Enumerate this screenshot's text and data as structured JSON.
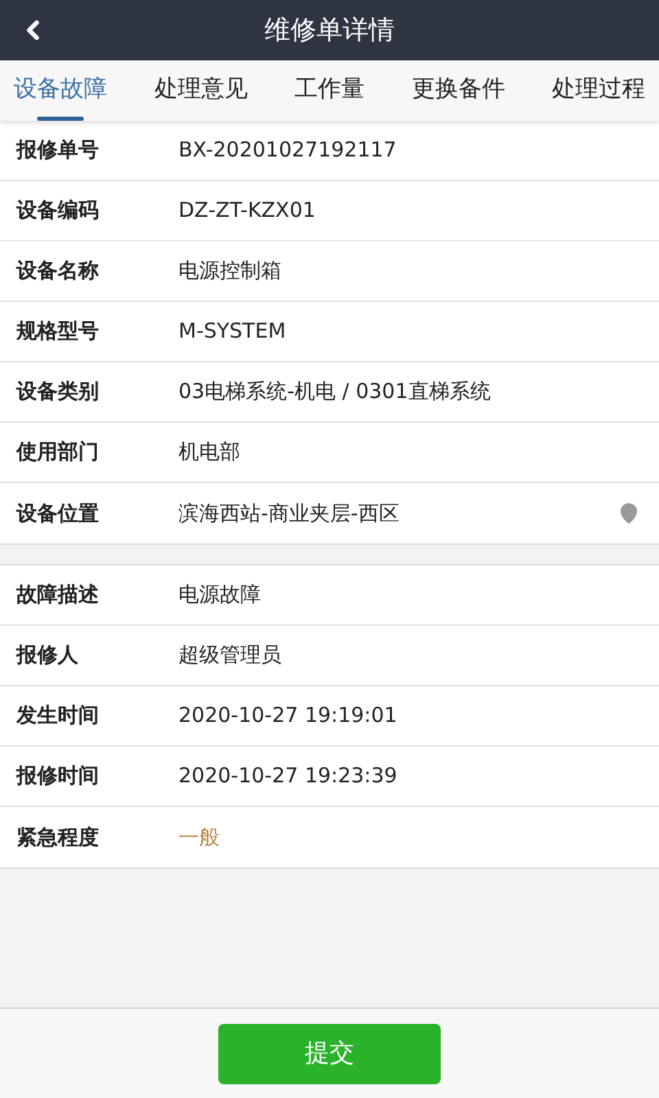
{
  "header": {
    "title": "维修单详情"
  },
  "tabs": [
    {
      "label": "设备故障",
      "selected": true
    },
    {
      "label": "处理意见",
      "selected": false
    },
    {
      "label": "工作量",
      "selected": false
    },
    {
      "label": "更换备件",
      "selected": false
    },
    {
      "label": "处理过程",
      "selected": false
    }
  ],
  "sections": [
    {
      "rows": [
        {
          "label": "报修单号",
          "value": "BX-20201027192117",
          "kind": "text"
        },
        {
          "label": "设备编码",
          "value": "DZ-ZT-KZX01",
          "kind": "text"
        },
        {
          "label": "设备名称",
          "value": "电源控制箱",
          "kind": "text"
        },
        {
          "label": "规格型号",
          "value": "M-SYSTEM",
          "kind": "text"
        },
        {
          "label": "设备类别",
          "value": "03电梯系统-机电 / 0301直梯系统",
          "kind": "text"
        },
        {
          "label": "使用部门",
          "value": "机电部",
          "kind": "text"
        },
        {
          "label": "设备位置",
          "value": "滨海西站-商业夹层-西区",
          "kind": "location"
        }
      ]
    },
    {
      "rows": [
        {
          "label": "故障描述",
          "value": "电源故障",
          "kind": "text"
        },
        {
          "label": "报修人",
          "value": "超级管理员",
          "kind": "text"
        },
        {
          "label": "发生时间",
          "value": "2020-10-27 19:19:01",
          "kind": "text"
        },
        {
          "label": "报修时间",
          "value": "2020-10-27 19:23:39",
          "kind": "text"
        },
        {
          "label": "紧急程度",
          "value": "一般",
          "kind": "urgency"
        }
      ]
    }
  ],
  "submit_button": "提交"
}
